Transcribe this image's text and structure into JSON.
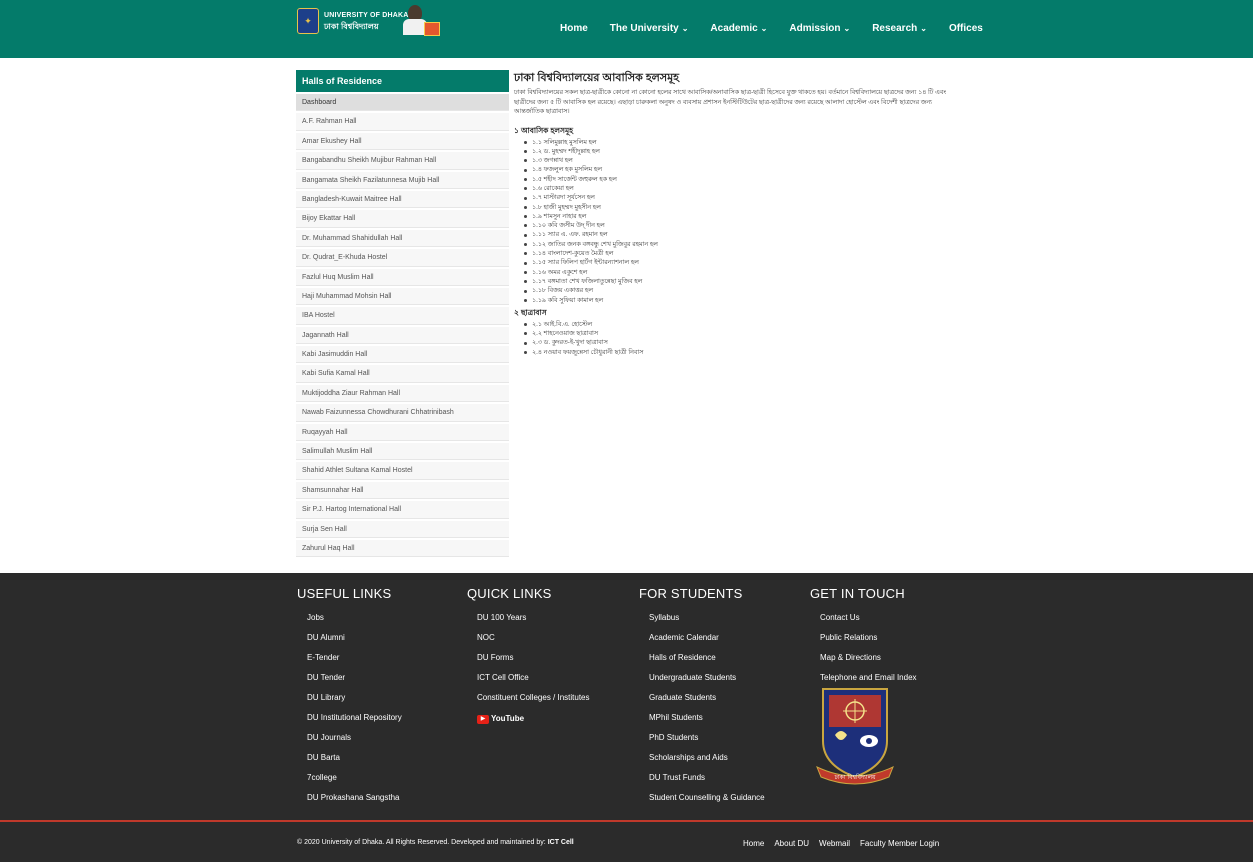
{
  "header": {
    "logo_en": "UNIVERSITY OF DHAKA",
    "logo_bn": "ঢাকা বিশ্ববিদ্যালয়",
    "nav": [
      {
        "label": "Home",
        "dropdown": false
      },
      {
        "label": "The University",
        "dropdown": true
      },
      {
        "label": "Academic",
        "dropdown": true
      },
      {
        "label": "Admission",
        "dropdown": true
      },
      {
        "label": "Research",
        "dropdown": true
      },
      {
        "label": "Offices",
        "dropdown": false
      }
    ],
    "chevron": "⌄"
  },
  "sidebar": {
    "heading": "Halls of Residence",
    "items": [
      "Dashboard",
      "A.F. Rahman Hall",
      "Amar Ekushey Hall",
      "Bangabandhu Sheikh Mujibur Rahman Hall",
      "Bangamata Sheikh Fazilatunnesa Mujib Hall",
      "Bangladesh-Kuwait Maitree Hall",
      "Bijoy Ekattar Hall",
      "Dr. Muhammad Shahidullah Hall",
      "Dr. Qudrat_E-Khuda Hostel",
      "Fazlul Huq Muslim Hall",
      "Haji Muhammad Mohsin Hall",
      "IBA Hostel",
      "Jagannath Hall",
      "Kabi Jasimuddin Hall",
      "Kabi Sufia Kamal Hall",
      "Muktijoddha Ziaur Rahman Hall",
      "Nawab Faizunnessa Chowdhurani Chhatrinibash",
      "Ruqayyah Hall",
      "Salimullah Muslim Hall",
      "Shahid Athlet Sultana Kamal Hostel",
      "Shamsunnahar Hall",
      "Sir P.J. Hartog International Hall",
      "Surja Sen Hall",
      "Zahurul Haq Hall"
    ]
  },
  "content": {
    "title": "ঢাকা বিশ্ববিদ্যালয়ের আবাসিক হলসমূহ",
    "intro": "ঢাকা বিশ্ববিদ্যালয়ের সকল ছাত্র-ছাত্রীকে কোনো না কোনো হলের সাথে আবাসিক/অনাবাসিক ছাত্র-ছাত্রী হিসেবে যুক্ত থাকতে হয়। বর্তমানে বিশ্ববিদ্যালয়ে ছাত্রদের জন্য ১৪ টি এবং ছাত্রীদের জন্য ৫ টি আবাসিক হল রয়েছে। এছাড়া চারুকলা অনুষদ ও ব্যবসায় প্রশাসন ইনস্টিটিউটের ছাত্র-ছাত্রীদের জন্য রয়েছে আলাদা হোস্টেল এবং বিদেশী ছাত্রদের জন্য আন্তর্জাতিক ছাত্রাবাস।",
    "section1_title": "১ আবাসিক হলসমূহ",
    "section1": [
      "১.১ সলিমুল্লাহ মুসলিম হল",
      "১.২ ড. মুহম্মদ শহীদুল্লাহ হল",
      "১.৩ জগন্নাথ হল",
      "১.৪ ফজলুল হক মুসলিম হল",
      "১.৫ শহীদ সার্জেন্ট জহুরুল হক হল",
      "১.৬ রোকেয়া হল",
      "১.৭ মাস্টারদা সূর্যসেন হল",
      "১.৮ হাজী মুহম্মদ মুহসীন হল",
      "১.৯ শামসুন নাহার হল",
      "১.১০ কবি জসীম উদ্‌ দীন হল",
      "১.১১ স্যার এ. এফ. রহমান হল",
      "১.১২ জাতির জনক বঙ্গবন্ধু শেখ মুজিবুর রহমান হল",
      "১.১৪ বাংলাদেশ-কুয়েত মৈত্রী হল",
      "১.১৫ স্যার ফিলিপ হার্টগ ইন্টারন্যাশনাল হল",
      "১.১৬ অমর একুশে হল",
      "১.১৭ বঙ্গমাতা শেখ ফজিলাতুন্নেছা মুজিব হল",
      "১.১৮ বিজয় একাত্তর হল",
      "১.১৯ কবি সুফিয়া কামাল হল"
    ],
    "section2_title": "২ ছাত্রাবাস",
    "section2": [
      "২.১ আই.বি.এ. হোস্টেল",
      "২.২ শাহনেওয়াজ ছাত্রাবাস",
      "২.৩ ড. কুদরত-ই-খুদা ছাত্রাবাস",
      "২.৪ নওয়াব ফয়জুন্নেসা চৌধুরানী ছাত্রী নিবাস"
    ]
  },
  "footer": {
    "columns": [
      {
        "heading": "USEFUL LINKS",
        "links": [
          "Jobs",
          "DU Alumni",
          "E-Tender",
          "DU Tender",
          "DU Library",
          "DU Institutional Repository",
          "DU Journals",
          "DU Barta",
          "7college",
          "DU Prokashana Sangstha"
        ]
      },
      {
        "heading": "QUICK LINKS",
        "links": [
          "DU 100 Years",
          "NOC",
          "DU Forms",
          "ICT Cell Office",
          "Constituent Colleges / Institutes"
        ]
      },
      {
        "heading": "FOR STUDENTS",
        "links": [
          "Syllabus",
          "Academic Calendar",
          "Halls of Residence",
          "Undergraduate Students",
          "Graduate Students",
          "MPhil Students",
          "PhD Students",
          "Scholarships and Aids",
          "DU Trust Funds",
          "Student Counselling & Guidance"
        ]
      },
      {
        "heading": "GET IN TOUCH",
        "links": [
          "Contact Us",
          "Public Relations",
          "Map & Directions",
          "Telephone and Email Index"
        ]
      }
    ],
    "youtube_label": "YouTube",
    "copyright_prefix": "© 2020 University of Dhaka. All Rights Reserved.  Developed and maintained by: ",
    "copyright_credit": "ICT Cell",
    "bottom_links": [
      "Home",
      "About DU",
      "Webmail",
      "Faculty Member Login"
    ],
    "emblem_caption": "ঢাকা বিশ্ববিদ্যালয়"
  },
  "colors": {
    "header_bg": "#047b6a",
    "footer_bg": "#2b2b2b",
    "divider": "#c0392b"
  }
}
